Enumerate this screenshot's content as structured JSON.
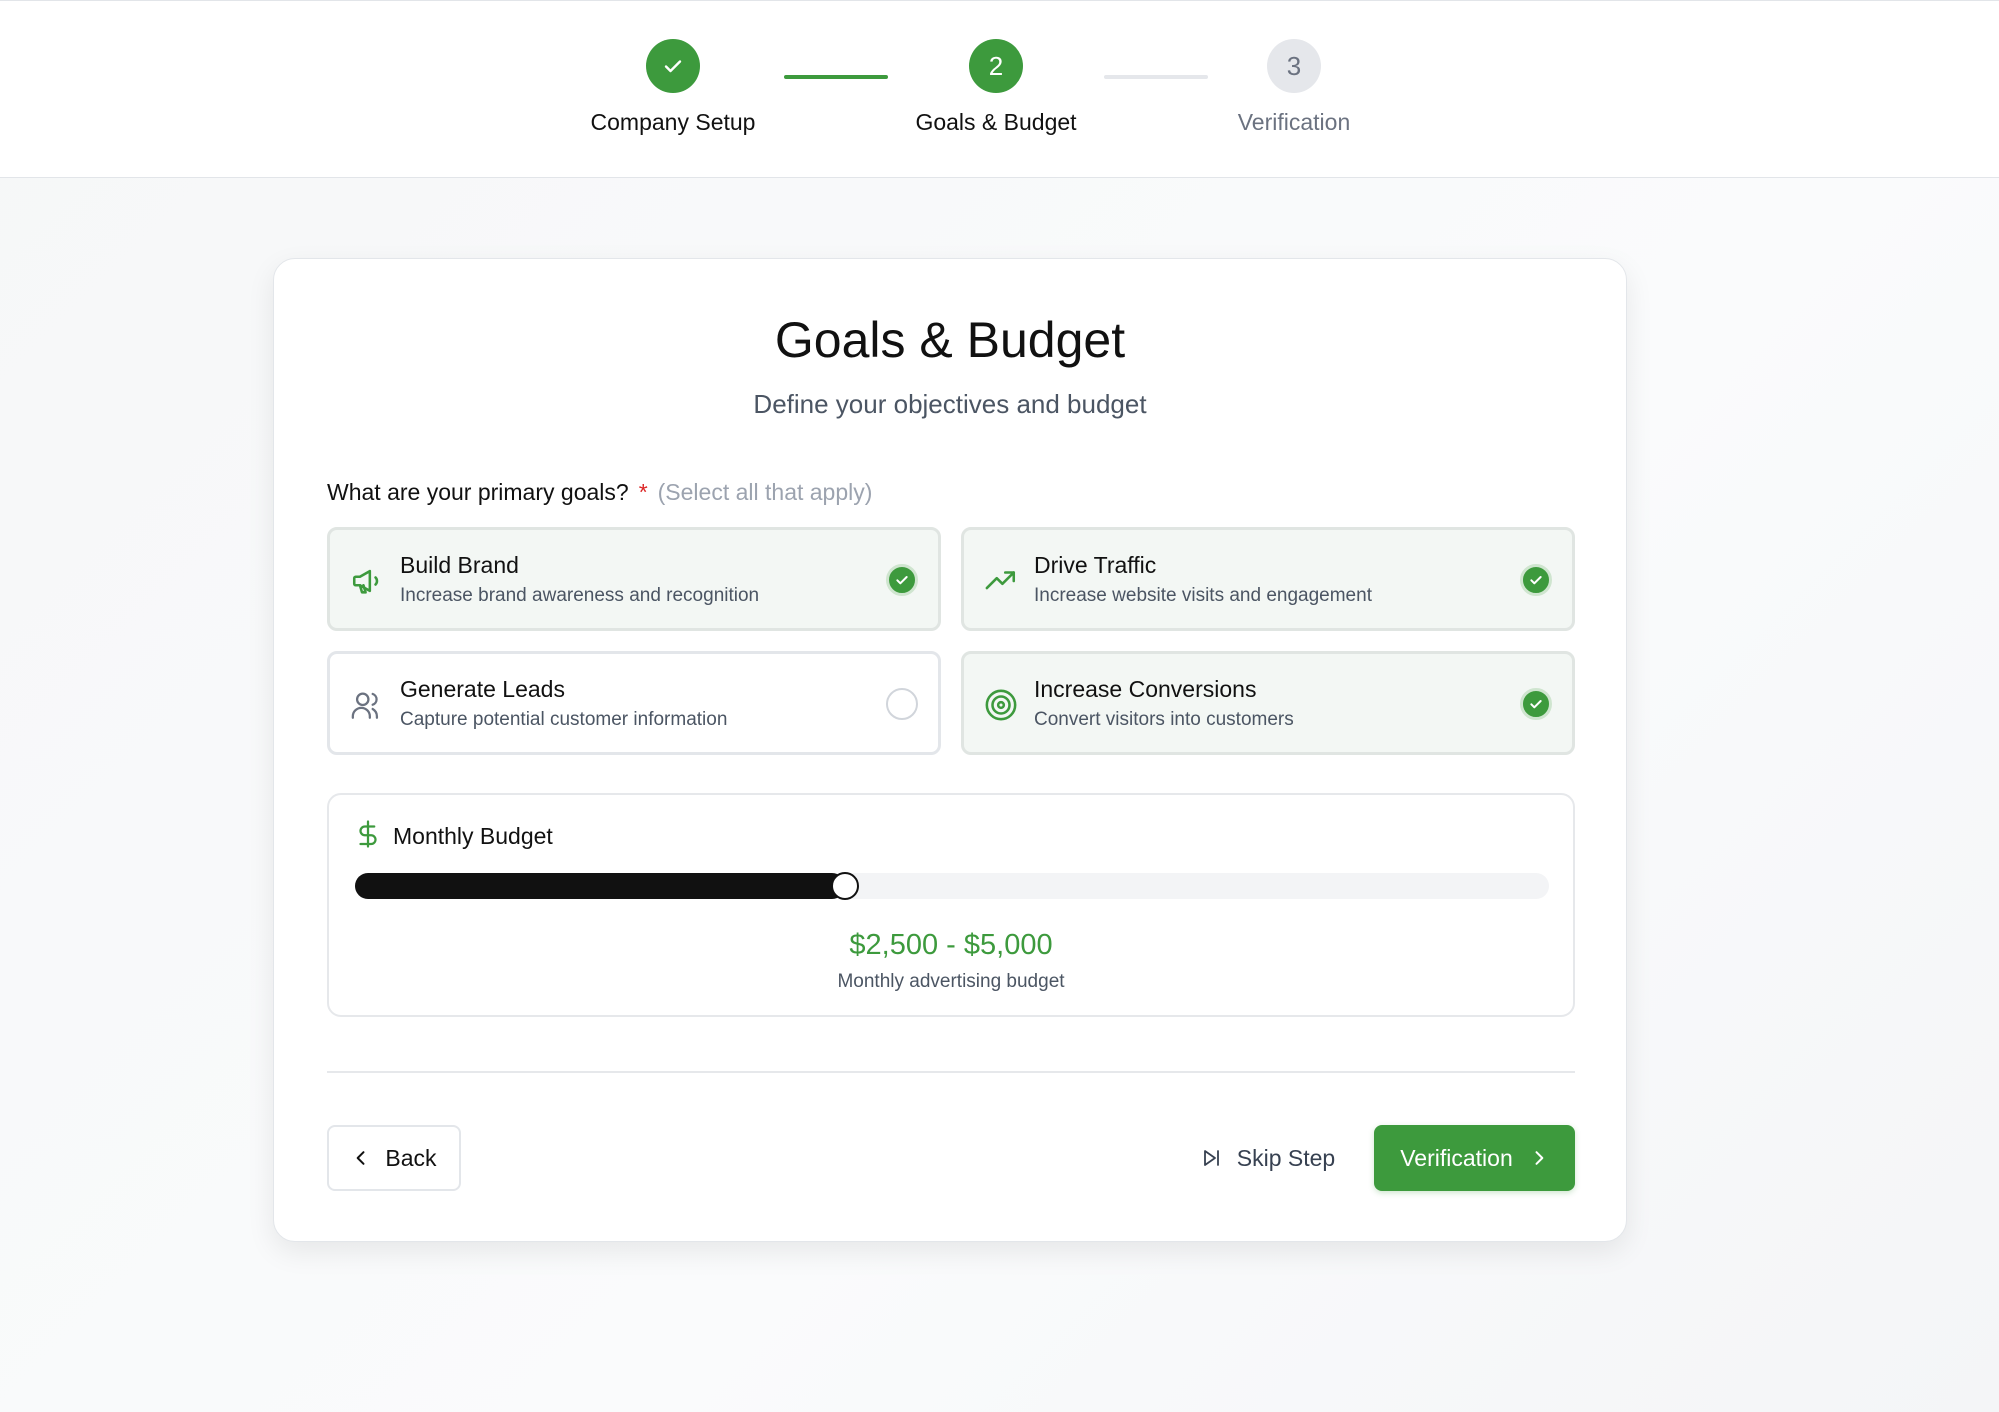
{
  "stepper": {
    "steps": [
      {
        "number": "1",
        "label": "Company Setup",
        "state": "completed"
      },
      {
        "number": "2",
        "label": "Goals & Budget",
        "state": "active"
      },
      {
        "number": "3",
        "label": "Verification",
        "state": "pending"
      }
    ]
  },
  "card": {
    "title": "Goals & Budget",
    "subtitle": "Define your objectives and budget"
  },
  "goals": {
    "question": "What are your primary goals?",
    "required_mark": "*",
    "hint": "(Select all that apply)",
    "options": [
      {
        "title": "Build Brand",
        "description": "Increase brand awareness and recognition",
        "icon": "megaphone-icon",
        "selected": true
      },
      {
        "title": "Drive Traffic",
        "description": "Increase website visits and engagement",
        "icon": "trending-up-icon",
        "selected": true
      },
      {
        "title": "Generate Leads",
        "description": "Capture potential customer information",
        "icon": "users-icon",
        "selected": false
      },
      {
        "title": "Increase Conversions",
        "description": "Convert visitors into customers",
        "icon": "target-icon",
        "selected": true
      }
    ]
  },
  "budget": {
    "title": "Monthly Budget",
    "icon": "dollar-icon",
    "slider_level": 0.41,
    "value": "$2,500 - $5,000",
    "caption": "Monthly advertising budget"
  },
  "footer": {
    "back_label": "Back",
    "skip_label": "Skip Step",
    "next_label": "Verification"
  },
  "colors": {
    "accent": "#3d9a3d",
    "required": "#dc2626",
    "slider_fill": "#111111"
  }
}
